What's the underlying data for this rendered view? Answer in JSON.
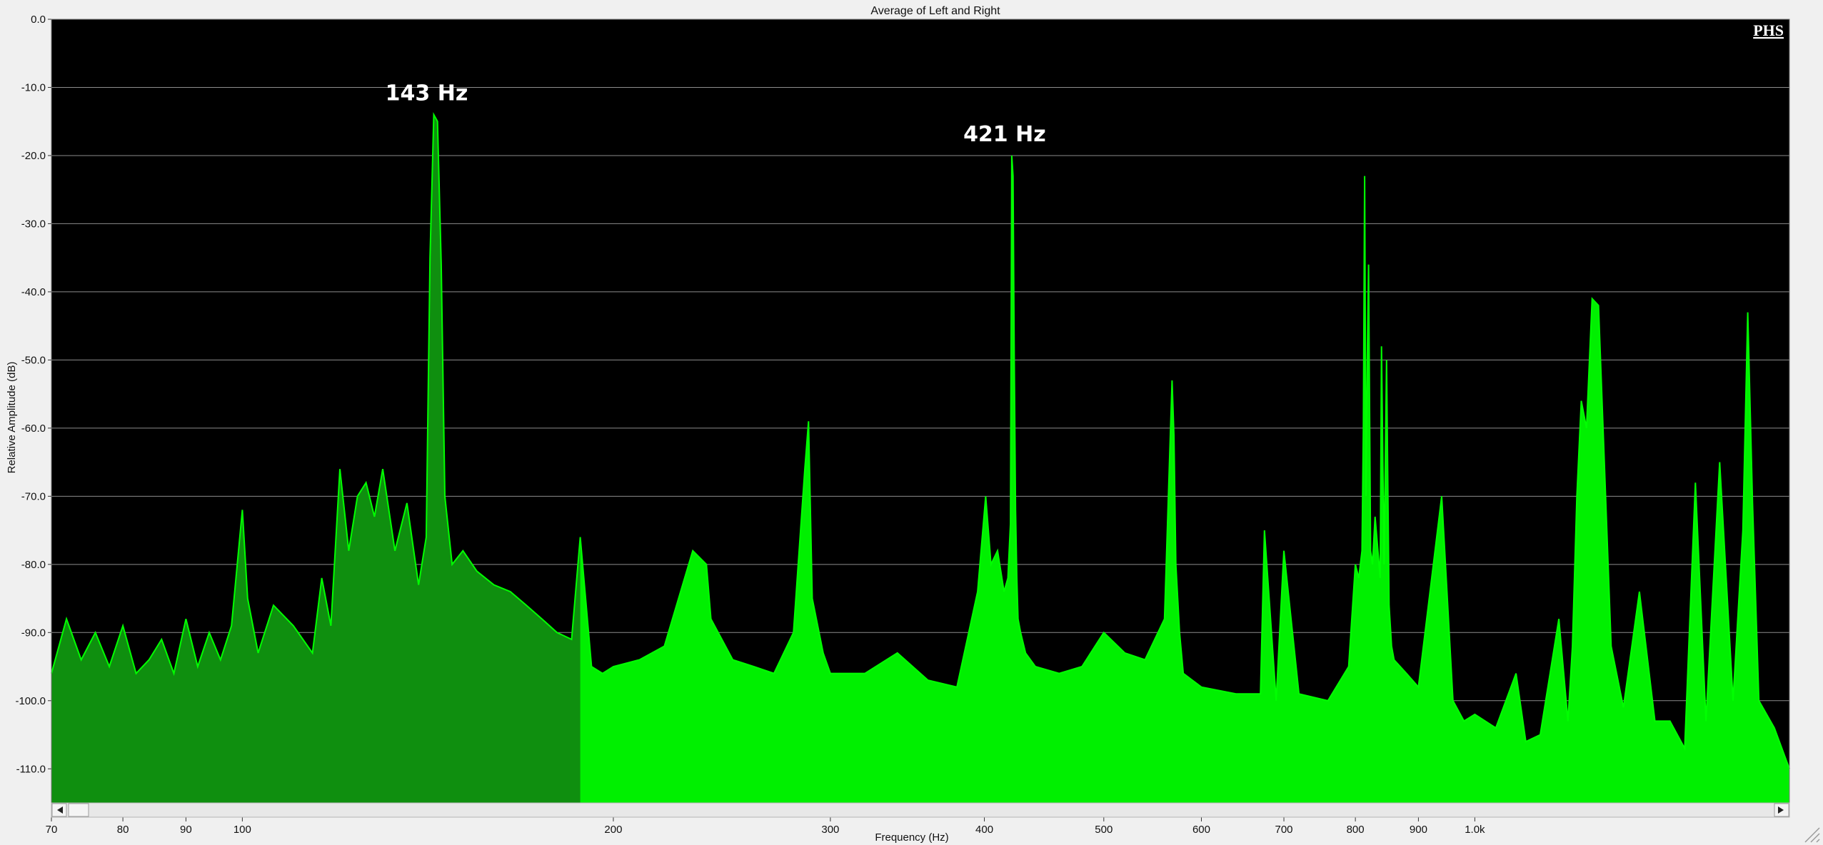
{
  "chart_data": {
    "type": "area",
    "title": "Average of Left and Right",
    "xlabel": "Frequency (Hz)",
    "ylabel": "Relative Amplitude (dB)",
    "x_scale": "log",
    "xlim": [
      70,
      1800
    ],
    "ylim": [
      -115,
      0
    ],
    "grid": true,
    "x_ticks": [
      70,
      80,
      90,
      100,
      200,
      300,
      400,
      500,
      600,
      700,
      800,
      900,
      1000
    ],
    "x_tick_labels": [
      "70",
      "80",
      "90",
      "100",
      "200",
      "300",
      "400",
      "500",
      "600",
      "700",
      "800",
      "900",
      "1.0k"
    ],
    "y_ticks": [
      0,
      -10,
      -20,
      -30,
      -40,
      -50,
      -60,
      -70,
      -80,
      -90,
      -100,
      -110
    ],
    "y_tick_labels": [
      "0.0",
      "-10.0",
      "-20.0",
      "-30.0",
      "-40.0",
      "-50.0",
      "-60.0",
      "-70.0",
      "-80.0",
      "-90.0",
      "-100.0",
      "-110.0"
    ],
    "background": "#000000",
    "gridline_color": "#8c8c8c",
    "line_color": "#00ff00",
    "fill_color": "#00f000",
    "low_fill_color": "#0f8f0f",
    "series": [
      {
        "x": [
          70,
          72,
          74,
          76,
          78,
          80,
          82,
          84,
          86,
          88,
          90,
          92,
          94,
          96,
          98,
          100,
          101,
          103,
          106,
          110,
          114,
          116,
          118,
          120,
          122,
          124,
          126,
          128,
          130,
          133,
          136,
          139,
          141,
          142,
          143,
          144,
          145,
          146,
          148,
          151,
          155,
          160,
          165,
          170,
          175,
          180,
          185,
          188,
          192,
          196,
          200,
          210,
          220,
          232,
          238,
          240,
          250,
          260,
          270,
          280,
          286,
          288,
          290,
          296,
          300,
          320,
          340,
          360,
          380,
          395,
          401,
          405,
          410,
          415,
          418,
          420,
          421,
          422,
          423,
          424,
          425,
          426,
          428,
          432,
          440,
          460,
          480,
          500,
          520,
          540,
          560,
          568,
          570,
          572,
          576,
          580,
          600,
          640,
          670,
          675,
          690,
          700,
          720,
          760,
          790,
          800,
          805,
          810,
          812,
          814,
          816,
          818,
          820,
          823,
          826,
          830,
          838,
          840,
          844,
          848,
          852,
          856,
          860,
          880,
          900,
          940,
          960,
          980,
          1000,
          1040,
          1080,
          1100,
          1130,
          1170,
          1190,
          1200,
          1210,
          1220,
          1232,
          1245,
          1260,
          1290,
          1320,
          1360,
          1400,
          1440,
          1480,
          1510,
          1540,
          1580,
          1620,
          1650,
          1665,
          1680,
          1700,
          1750,
          1800
        ],
        "y": [
          -96,
          -88,
          -94,
          -90,
          -95,
          -89,
          -96,
          -94,
          -91,
          -96,
          -88,
          -95,
          -90,
          -94,
          -89,
          -72,
          -85,
          -93,
          -86,
          -89,
          -93,
          -82,
          -89,
          -66,
          -78,
          -70,
          -68,
          -73,
          -66,
          -78,
          -71,
          -83,
          -76,
          -35,
          -14,
          -15,
          -36,
          -70,
          -80,
          -78,
          -81,
          -83,
          -84,
          -86,
          -88,
          -90,
          -91,
          -76,
          -95,
          -96,
          -95,
          -94,
          -92,
          -78,
          -80,
          -88,
          -94,
          -95,
          -96,
          -90,
          -66,
          -59,
          -85,
          -93,
          -96,
          -96,
          -93,
          -97,
          -98,
          -84,
          -70,
          -80,
          -78,
          -84,
          -82,
          -74,
          -20,
          -23,
          -50,
          -72,
          -82,
          -88,
          -90,
          -93,
          -95,
          -96,
          -95,
          -90,
          -93,
          -94,
          -88,
          -53,
          -61,
          -80,
          -90,
          -96,
          -98,
          -99,
          -99,
          -75,
          -100,
          -78,
          -99,
          -100,
          -95,
          -80,
          -82,
          -78,
          -60,
          -23,
          -70,
          -50,
          -36,
          -78,
          -80,
          -73,
          -82,
          -48,
          -80,
          -50,
          -86,
          -92,
          -94,
          -96,
          -98,
          -70,
          -100,
          -103,
          -102,
          -104,
          -96,
          -106,
          -105,
          -88,
          -103,
          -92,
          -70,
          -56,
          -60,
          -41,
          -42,
          -92,
          -101,
          -84,
          -103,
          -103,
          -107,
          -68,
          -103,
          -65,
          -100,
          -75,
          -43,
          -71,
          -100,
          -104,
          -110
        ]
      }
    ],
    "annotations": [
      {
        "text": "143 Hz",
        "x": 143,
        "y": -14
      },
      {
        "text": "421 Hz",
        "x": 421,
        "y": -20
      }
    ],
    "watermark": "PHS"
  }
}
